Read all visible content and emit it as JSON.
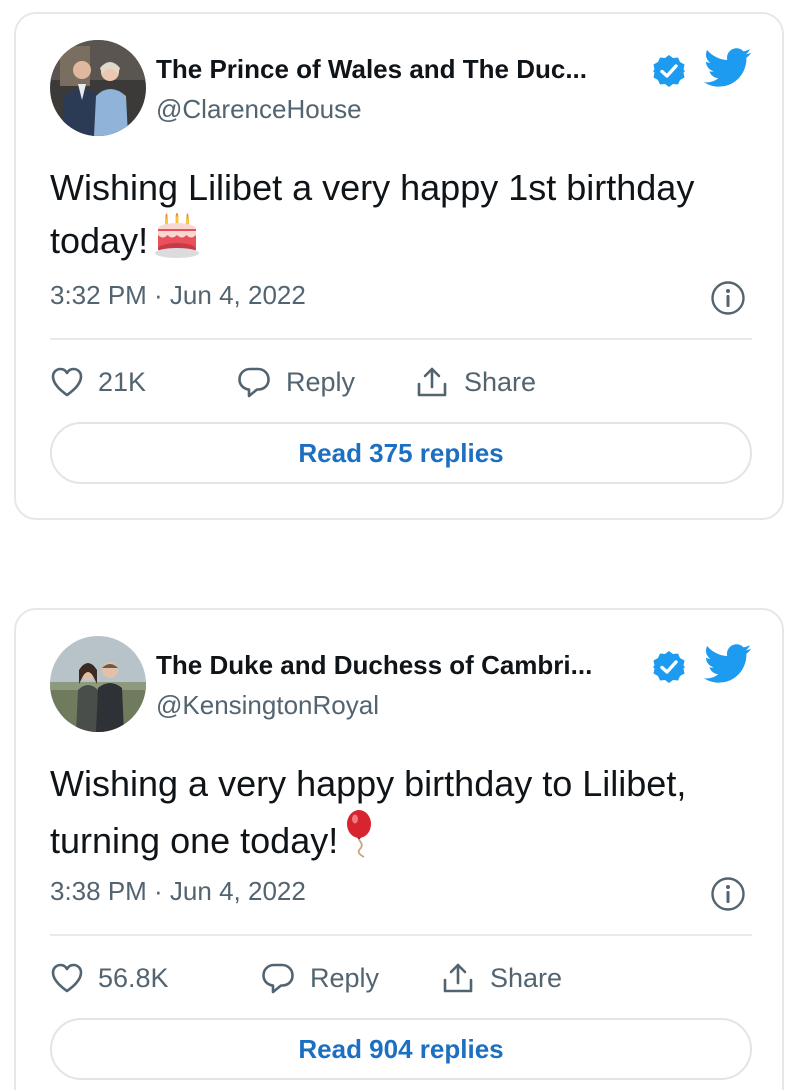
{
  "tweets": [
    {
      "display_name": "The Prince of Wales and The Duc...",
      "handle": "@ClarenceHouse",
      "text": "Wishing Lilibet a very happy 1st birthday today!",
      "emoji": "birthday-cake",
      "timestamp": "3:32 PM · Jun 4, 2022",
      "likes": "21K",
      "reply_label": "Reply",
      "share_label": "Share",
      "read_replies_label": "Read 375 replies",
      "avatar_icon": "avatar-photo",
      "verified_icon": "verified-badge-icon"
    },
    {
      "display_name": "The Duke and Duchess of Cambri...",
      "handle": "@KensingtonRoyal",
      "text": "Wishing a very happy birthday to Lilibet, turning one today!",
      "emoji": "balloon",
      "timestamp": "3:38 PM · Jun 4, 2022",
      "likes": "56.8K",
      "reply_label": "Reply",
      "share_label": "Share",
      "read_replies_label": "Read 904 replies",
      "avatar_icon": "avatar-photo",
      "verified_icon": "verified-badge-icon"
    }
  ],
  "colors": {
    "twitter_blue": "#1d9bf0",
    "link_blue": "#1d6fc2",
    "secondary_text": "#536471",
    "border": "#e4e8eb"
  }
}
